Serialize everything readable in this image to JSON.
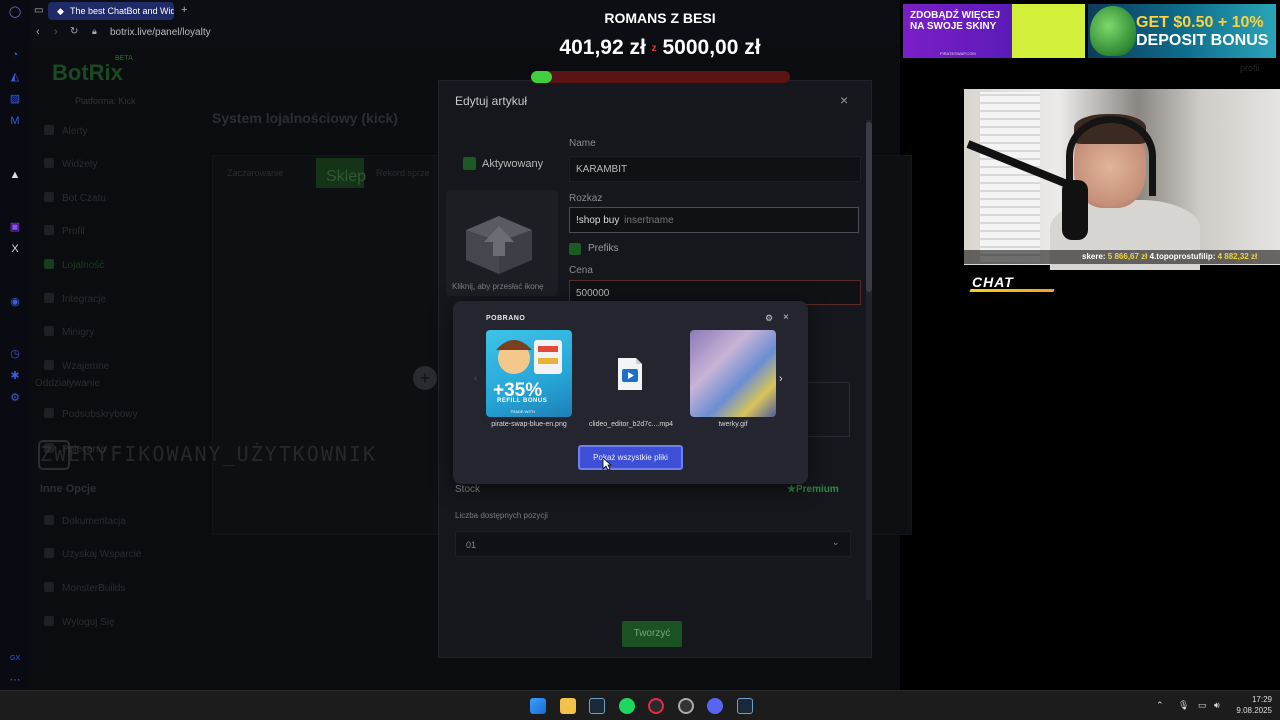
{
  "browser": {
    "tab_title": "The best ChatBot and Wid",
    "url": "botrix.live/panel/loyalty",
    "new_tab": "+"
  },
  "app": {
    "logo": "BotRix",
    "logo_badge": "BETA",
    "platform": "Platforma: Kick",
    "page_title": "System lojalnościowy (kick)",
    "sidebar": [
      {
        "label": "Alerty"
      },
      {
        "label": "Widżety"
      },
      {
        "label": "Bot Czatu"
      },
      {
        "label": "Profil"
      },
      {
        "label": "Lojalność"
      },
      {
        "label": "Integracje"
      },
      {
        "label": "Minigry"
      },
      {
        "label": "Wzajemne"
      },
      {
        "label": "Oddziaływanie"
      },
      {
        "label": "Podsubskrybowy"
      },
      {
        "label": "Polecenia"
      }
    ],
    "sidebar_section": "Inne Opcje",
    "sidebar_other": [
      {
        "label": "Dokumentacja"
      },
      {
        "label": "Uzyskaj Wsparcie"
      },
      {
        "label": "MonsterBuilds"
      },
      {
        "label": "Wyloguj Się"
      }
    ],
    "content_tabs": [
      {
        "label": "Zaczarowanie"
      },
      {
        "label": "Sklep"
      },
      {
        "label": "Rekord sprze"
      }
    ],
    "watermark": "ZWERYFIKOWANY_UŻYTKOWNIK",
    "profile_link": "profil"
  },
  "modal": {
    "title": "Edytuj artykuł",
    "close": "×",
    "active_label": "Aktywowany",
    "upload_text": "Kliknij, aby przesłać ikonę",
    "name_label": "Name",
    "name_value": "KARAMBIT",
    "command_label": "Rozkaz",
    "command_value": "!shop buy",
    "command_placeholder": "insertname",
    "prefix_label": "Prefiks",
    "price_label": "Cena",
    "price_value": "500000",
    "stock_label": "Stock",
    "premium_label": "Premium",
    "available_label": "Liczba dostępnych pozycji",
    "stock_value": "01",
    "create_button": "Tworzyć"
  },
  "downloads": {
    "title": "POBRANO",
    "files": [
      {
        "name": "pirate-swap-blue-en.png",
        "icon": "image-thumbnail"
      },
      {
        "name": "clideo_editor_b2d7c....mp4",
        "icon": "video-file-icon"
      },
      {
        "name": "twerky.gif",
        "icon": "image-thumbnail"
      }
    ],
    "thumb_1_big": "+35%",
    "thumb_1_sub": "REFILL BONUS",
    "thumb_1_small": "TRADE WITH",
    "show_all_button": "Pokaż wszystkie pliki"
  },
  "overlay": {
    "goal_title": "ROMANS Z BESI",
    "goal_current": "401,92 zł",
    "goal_separator": "z",
    "goal_target": "5000,00 zł",
    "goal_progress_fraction": 0.08,
    "ad_1_text_line1": "ZDOBĄDŹ WIĘCEJ",
    "ad_1_text_line2": "NA SWOJE SKINY",
    "ad_1_footer": "PIRATESWAP.COM",
    "ad_2_line1": "GET $0.50 + 10%",
    "ad_2_line2": "DEPOSIT BONUS",
    "ticker_prefix": "skere: ",
    "ticker_amount_1": "5 866,67 zł",
    "ticker_mid": "  4.topoprostufilip: ",
    "ticker_amount_2": "4 882,32 zł",
    "chat_label": "CHAT"
  },
  "taskbar": {
    "time": "17:29",
    "date": "9.08.2025"
  },
  "colors": {
    "accent_green": "#1c5a25",
    "download_button": "#3c4fd6",
    "goal_fill": "#3fcf3f",
    "goal_track": "#5a1414"
  }
}
